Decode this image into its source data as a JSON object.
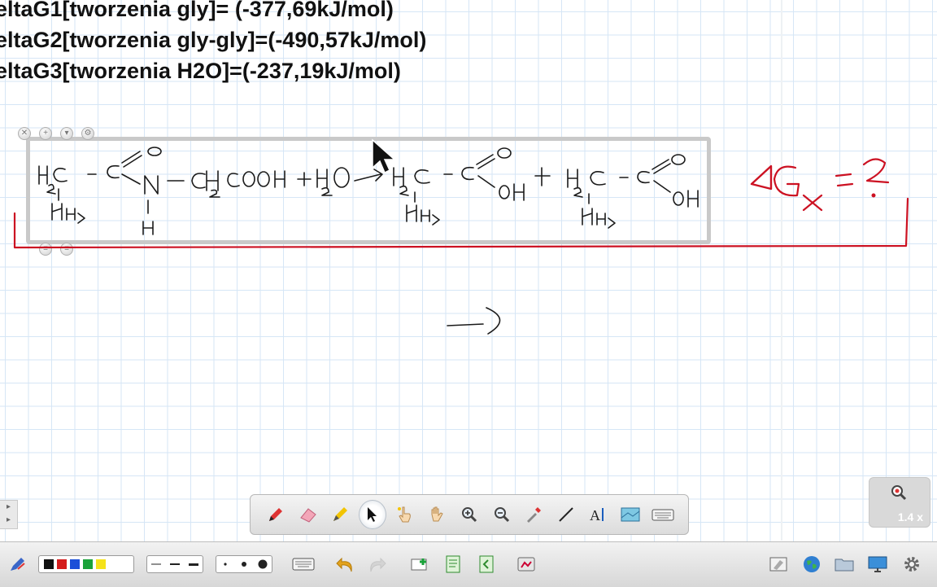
{
  "equations": [
    "eltaG1[tworzenia gly]= (-377,69kJ/mol)",
    "eltaG2[tworzenia gly-gly]=(-490,57kJ/mol)",
    "eltaG3[tworzenia H2O]=(-237,19kJ/mol)"
  ],
  "zoom": {
    "level": "1.4 x"
  },
  "colors": {
    "red_ink": "#cc1122",
    "black_ink": "#1a1a1a",
    "grid": "#d6e6f6",
    "swatch_black": "#111111",
    "swatch_red": "#d41c1c",
    "swatch_blue": "#1b4fd8",
    "swatch_green": "#1aa23a",
    "swatch_yellow": "#f5e21a"
  },
  "toolbar": {
    "tools": [
      "pen-icon",
      "eraser-icon",
      "highlighter-icon",
      "select-arrow-icon",
      "pointer-hand-icon",
      "pan-hand-icon",
      "zoom-in-icon",
      "zoom-out-icon",
      "color-picker-icon",
      "line-icon",
      "text-icon",
      "screen-capture-icon",
      "keyboard-icon"
    ]
  },
  "bottombar": {
    "icons": [
      "pen-settings-icon",
      "keyboard-icon",
      "undo-icon",
      "redo-icon",
      "add-page-icon",
      "page-icon",
      "page-prev-icon",
      "gallery-icon",
      "transparent-mode-icon",
      "globe-icon",
      "folder-icon",
      "display-icon",
      "settings-icon"
    ]
  }
}
